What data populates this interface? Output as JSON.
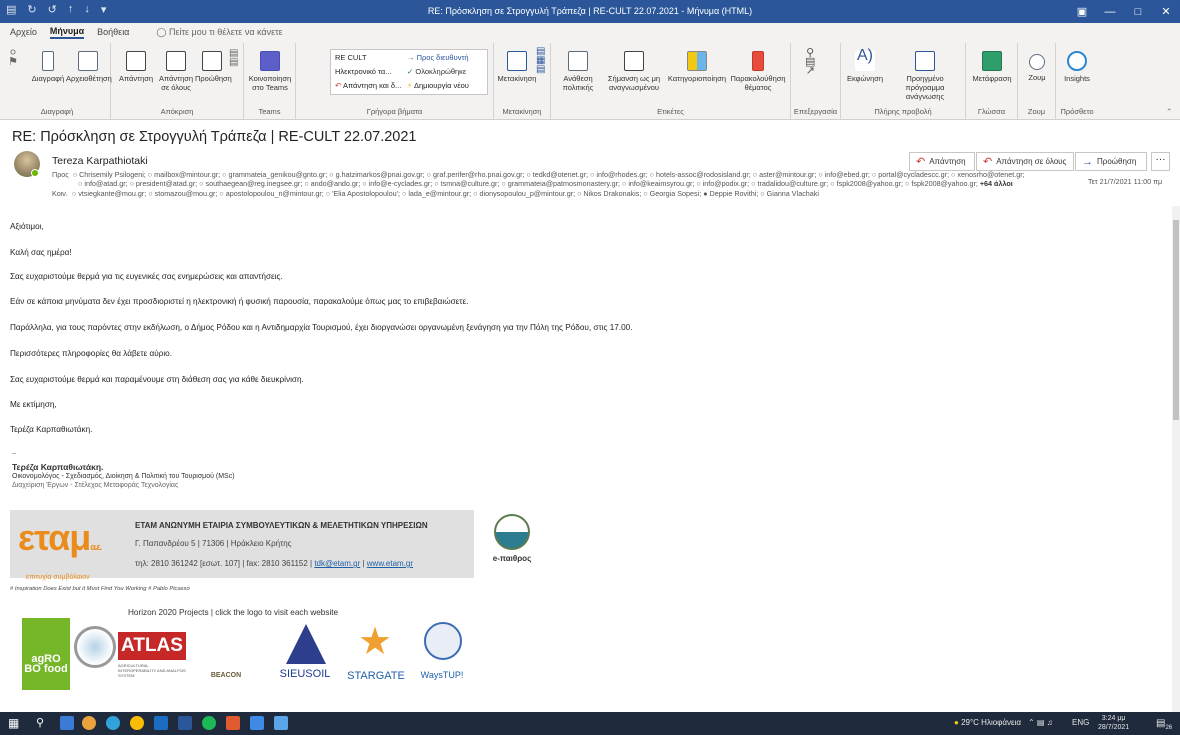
{
  "window": {
    "title": "RE: Πρόσκληση σε Στρογγυλή Τράπεζα | RE-CULT 22.07.2021 - Μήνυμα (HTML)",
    "quick_access": [
      "↻",
      "↺",
      "↑",
      "↓",
      "▾"
    ],
    "controls": [
      "▣",
      "—",
      "□",
      "✕"
    ]
  },
  "menu_tabs": {
    "file": "Αρχείο",
    "message": "Μήνυμα",
    "help": "Βοήθεια",
    "tell_me": "Πείτε μου τι θέλετε να κάνετε"
  },
  "ribbon": {
    "groups": {
      "delete": "Διαγραφή",
      "respond": "Απόκριση",
      "teams": "Teams",
      "quick_steps": "Γρήγορα βήματα",
      "move": "Μετακίνηση",
      "tags": "Ετικέτες",
      "editing": "Επεξεργασία",
      "immersive": "Πλήρης προβολή",
      "language": "Γλώσσα",
      "zoom": "Ζουμ",
      "addins": "Πρόσθετο"
    },
    "buttons": {
      "delete": "Διαγραφή",
      "archive": "Αρχειοθέτηση",
      "reply": "Απάντηση",
      "reply_all": "Απάντηση σε όλους",
      "forward": "Προώθηση",
      "share_teams": "Κοινοποίηση στο Teams",
      "move": "Μετακίνηση",
      "assign_policy": "Ανάθεση πολιτικής",
      "mark_unread": "Σήμανση ως μη αναγνωσμένου",
      "categorize": "Κατηγοριοποίηση",
      "follow_up": "Παρακολούθηση θέματος",
      "read_aloud": "Εκφώνηση",
      "immersive_reader": "Προηγμένο πρόγραμμα ανάγνωσης",
      "translate": "Μετάφραση",
      "zoom": "Ζουμ",
      "insights": "Insights"
    },
    "quick_steps": [
      "RE CULT",
      "Προς διευθυντή",
      "Ηλεκτρονικό τα...",
      "Ολοκληρώθηκε",
      "Απάντηση και δ...",
      "Δημιουργία νέου"
    ]
  },
  "message": {
    "subject": "RE: Πρόσκληση σε Στρογγυλή Τράπεζα | RE-CULT 22.07.2021",
    "sender": "Tereza Karpathiotaki",
    "to_label": "Προς",
    "to_line1": "Chrisemily Psilogeni; ○ mailbox@mintour.gr; ○ grammateia_genikou@gnto.gr; ○ g.hatzimarkos@pnai.gov.gr; ○ graf.perifer@rho.pnai.gov.gr; ○ tedkd@otenet.gr; ○ info@rhodes.gr; ○ hotels-assoc@rodosisland.gr; ○ aster@mintour.gr; ○ info@ebed.gr; ○ portal@cycladescc.gr; ○ xenosrho@otenet.gr;",
    "to_line2": "info@atad.gr; ○ president@atad.gr; ○ southaegean@reg.inegsee.gr; ○ ando@ando.gr; ○ info@e-cyclades.gr; ○ tsmna@culture.gr; ○ grammateia@patmosmonastery.gr; ○ info@keaimsyrou.gr; ○ info@podix.gr; ○ tradalidou@culture.gr; ○ fspk2008@yahoo.gr; ○ fspk2008@yahoo.gr;",
    "to_more": "+64 άλλοι",
    "cc_label": "Κοιν.",
    "cc_line": "vtsiegkante@mou.gr; ○ stomazou@mou.gr; ○ apostolopoulou_n@mintour.gr; ○ 'Elia Apostolopoulou'; ○ lada_e@mintour.gr; ○ dionysopoulou_p@mintour.gr; ○ Nikos Drakonakis; ○ Georgia Sopesi; ● Deppie Rovithi; ○ Gianna Vlachaki",
    "date": "Τετ 21/7/2021 11:00 πμ",
    "actions": {
      "reply": "Απάντηση",
      "reply_all": "Απάντηση σε όλους",
      "forward": "Προώθηση",
      "more": "···"
    },
    "body": [
      "Αξιότιμοι,",
      "Καλή σας ημέρα!",
      "Σας ευχαριστούμε θερμά για τις ευγενικές σας ενημερώσεις και απαντήσεις.",
      "Εάν σε κάποια μηνύματα δεν έχει προσδιοριστεί η ηλεκτρονική ή φυσική παρουσία, παρακαλούμε όπως μας το επιβεβαιώσετε.",
      "Παράλληλα, για τους παρόντες στην εκδήλωση, ο Δήμος Ρόδου και η Αντιδημαρχία Τουρισμού,  έχει διοργανώσει οργανωμένη ξενάγηση για την Πόλη της Ρόδου, στις 17.00.",
      "Περισσότερες πληροφορίες θα λάβετε αύριο.",
      "Σας ευχαριστούμε θερμά και παραμένουμε στη διάθεση σας για κάθε διευκρίνιση.",
      "Με εκτίμηση,",
      "Τερέζα Καρπαθιωτάκη."
    ],
    "signature": {
      "dash": "--",
      "name": "Τερέζα Καρπαθιωτάκη.",
      "role": "Οικονομολόγος - Σχεδιασμός, Διοίκηση & Πολιτική του Τουρισμού (MSc)",
      "dept": "Διαχείριση Έργων - Στέλεχος Μεταφοράς Τεχνολογίας",
      "company_logo": "εταμ",
      "company_logo_suffix": "α.ε.",
      "company_tagline": "επιτυχία συμβόλαιον",
      "company": "ΕΤΑΜ ΑΝΩΝΥΜΗ ΕΤΑΙΡΙΑ ΣΥΜΒΟΥΛΕΥΤΙΚΩΝ & ΜΕΛΕΤΗΤΙΚΩΝ ΥΠΗΡΕΣΙΩΝ",
      "address": "Γ. Παπανδρέου 5 | 71306 | Ηράκλειο Κρήτης",
      "phones": "τηλ: 2810 361242 [εσωτ. 107] | fax: 2810 361152 |",
      "email": "tdk@etam.gr",
      "website": "www.etam.gr",
      "epaithros": "e-παιθρος",
      "quote": "# Inspiration Does Exist but it Must Find You Working # Pablo Picasso",
      "horizon": "Horizon 2020 Projects | click the logo to visit each website"
    },
    "projects": {
      "agrobofood": "agRO BO food",
      "atlas": "ATLAS",
      "atlas_sub": "AGRICULTURAL INTEROPERABILITY AND ANALYSIS SYSTEM",
      "beacon": "BEACON",
      "sieusoil": "SIEUSOIL",
      "stargate": "STARGATE",
      "waystup": "WaysTUP!"
    }
  },
  "taskbar": {
    "weather": "29°C Ηλιοφάνεια",
    "lang": "ENG",
    "time": "3:24 μμ",
    "date": "28/7/2021",
    "notif_count": "26"
  }
}
